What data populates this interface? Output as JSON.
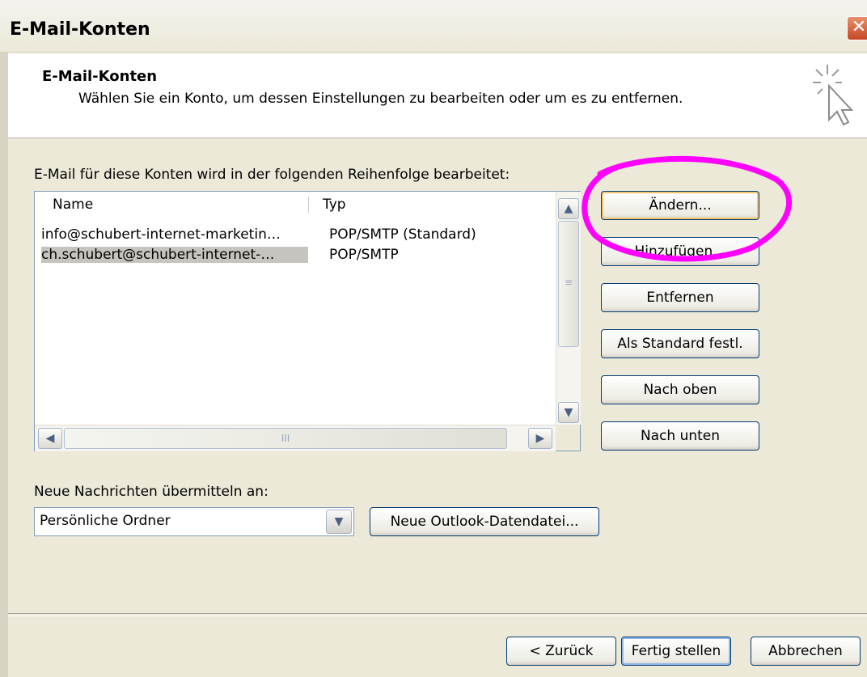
{
  "window": {
    "title": "E-Mail-Konten",
    "close_glyph": "✕"
  },
  "header": {
    "title": "E-Mail-Konten",
    "subtitle": "Wählen Sie ein Konto, um dessen Einstellungen zu bearbeiten oder um es zu entfernen.",
    "icon": "cursor-sparkle-icon"
  },
  "accounts": {
    "label": "E-Mail für diese Konten wird in der folgenden Reihenfolge bearbeitet:",
    "columns": [
      "Name",
      "Typ"
    ],
    "rows": [
      {
        "name": "info@schubert-internet-marketin…",
        "type": "POP/SMTP (Standard)",
        "selected": false
      },
      {
        "name": "ch.schubert@schubert-internet-…",
        "type": "POP/SMTP",
        "selected": true
      }
    ],
    "scroll_grip": "≡",
    "hscroll_grip": "III"
  },
  "side_buttons": {
    "change": "Ändern...",
    "add": "Hinzufügen...",
    "remove": "Entfernen",
    "set_default": "Als Standard festl.",
    "move_up": "Nach oben",
    "move_down": "Nach unten"
  },
  "delivery": {
    "label": "Neue Nachrichten übermitteln an:",
    "selected": "Persönliche Ordner",
    "new_file_button": "Neue Outlook-Datendatei..."
  },
  "footer": {
    "back": "< Zurück",
    "finish": "Fertig stellen",
    "cancel": "Abbrechen"
  },
  "annotation": {
    "color": "#ff00ff",
    "target": "Ändern..."
  }
}
